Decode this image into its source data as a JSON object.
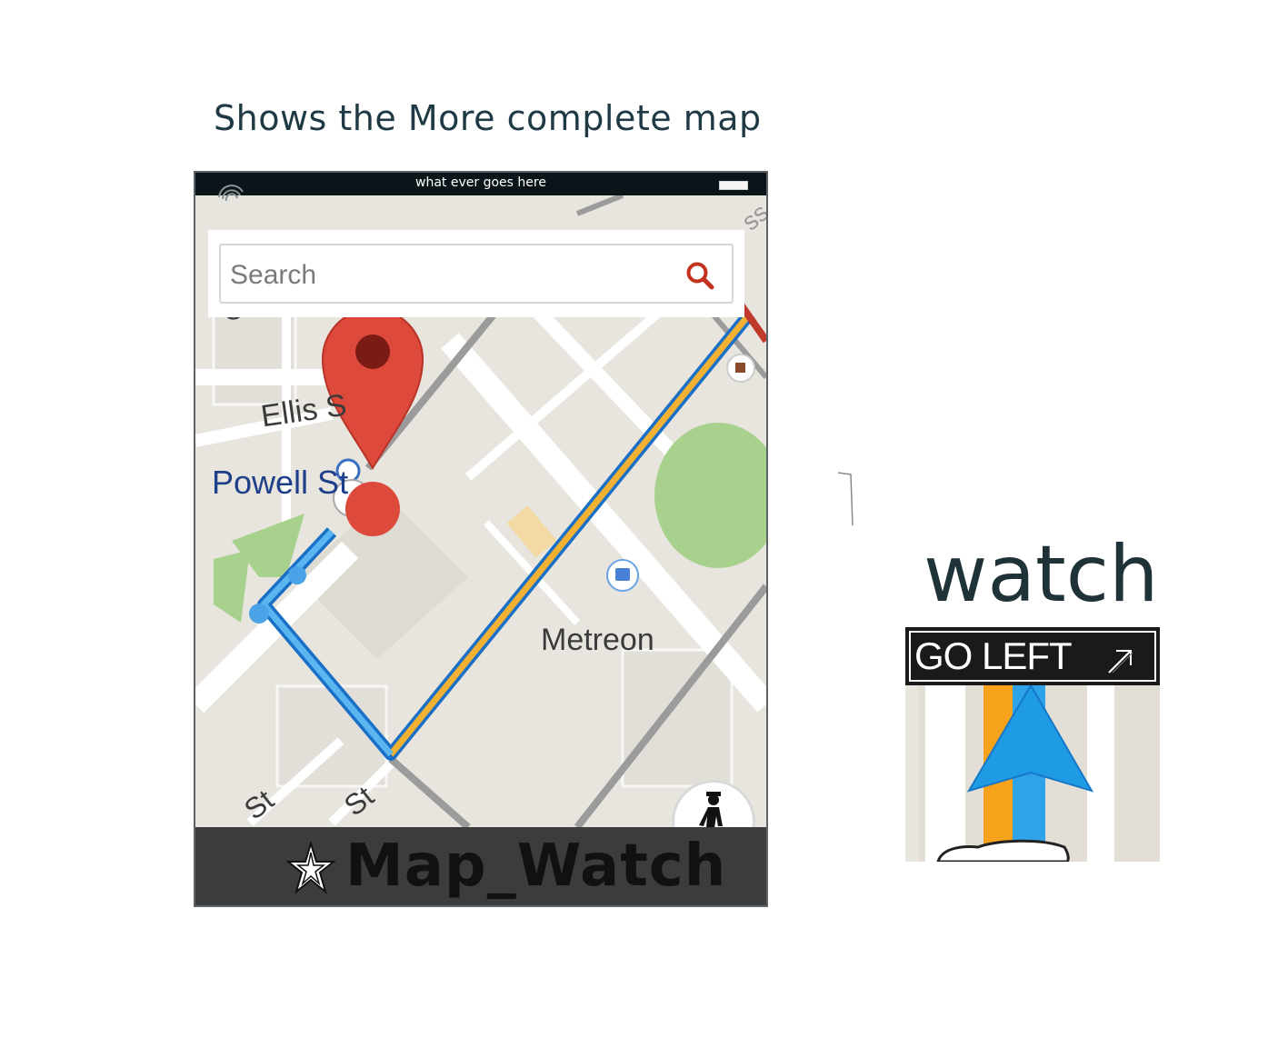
{
  "page": {
    "heading": "Shows the More complete map"
  },
  "phone": {
    "status_text": "what ever goes here",
    "search": {
      "placeholder": "Search"
    },
    "map_labels": {
      "street_top": "O'Farrell",
      "ellis": "Ellis S",
      "powell": "Powell St",
      "metreon": "Metreon",
      "st_left": "St",
      "st_mid": "St",
      "corner": "ss"
    },
    "app_title": "Map_Watch"
  },
  "watch": {
    "heading": "watch",
    "direction": "GO LEFT"
  },
  "colors": {
    "route_blue": "#1a6fc6",
    "route_yellow": "#f2b132",
    "pin_red": "#dd4a3c",
    "bottom_bar": "#3a3c3d",
    "status_bar": "#0b1418"
  },
  "icons": [
    "search-icon",
    "star-icon",
    "walking-person-icon",
    "map-pin-icon",
    "turn-arrow-icon",
    "navigation-arrow-icon"
  ]
}
